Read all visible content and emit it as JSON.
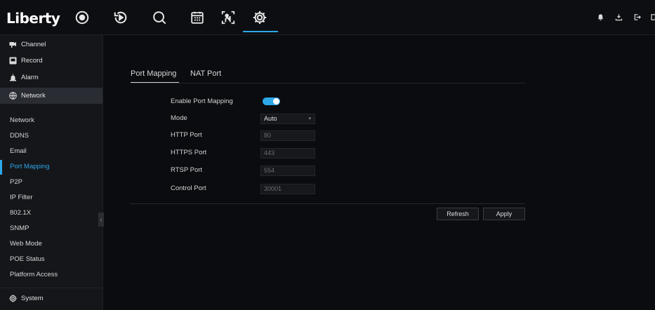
{
  "brand": {
    "logo": "Liberty",
    "accent": "#2ca8e8"
  },
  "topnav": {
    "icons": [
      "live-view-icon",
      "playback-icon",
      "search-icon",
      "calendar-icon",
      "smart-analytics-icon",
      "settings-icon"
    ],
    "active": "settings-icon",
    "right_icons": [
      "bell-icon",
      "download-icon",
      "logout-icon",
      "screen-icon"
    ]
  },
  "sidebar": {
    "main": [
      {
        "label": "Channel",
        "icon": "camera-icon"
      },
      {
        "label": "Record",
        "icon": "record-icon"
      },
      {
        "label": "Alarm",
        "icon": "alarm-icon"
      },
      {
        "label": "Network",
        "icon": "network-icon",
        "active": true
      },
      {
        "label": "System",
        "icon": "gear-icon"
      }
    ],
    "sub": [
      "Network",
      "DDNS",
      "Email",
      "Port Mapping",
      "P2P",
      "IP Filter",
      "802.1X",
      "SNMP",
      "Web Mode",
      "POE Status",
      "Platform Access"
    ],
    "active_sub": "Port Mapping",
    "collapse_glyph": "‹"
  },
  "tabs": [
    {
      "label": "Port Mapping",
      "active": true
    },
    {
      "label": "NAT Port",
      "active": false
    }
  ],
  "form": {
    "enable_label": "Enable Port Mapping",
    "enable_value": true,
    "mode_label": "Mode",
    "mode_value": "Auto",
    "http_label": "HTTP Port",
    "http_value": "80",
    "https_label": "HTTPS Port",
    "https_value": "443",
    "rtsp_label": "RTSP Port",
    "rtsp_value": "554",
    "control_label": "Control Port",
    "control_value": "30001"
  },
  "buttons": {
    "refresh": "Refresh",
    "apply": "Apply"
  }
}
